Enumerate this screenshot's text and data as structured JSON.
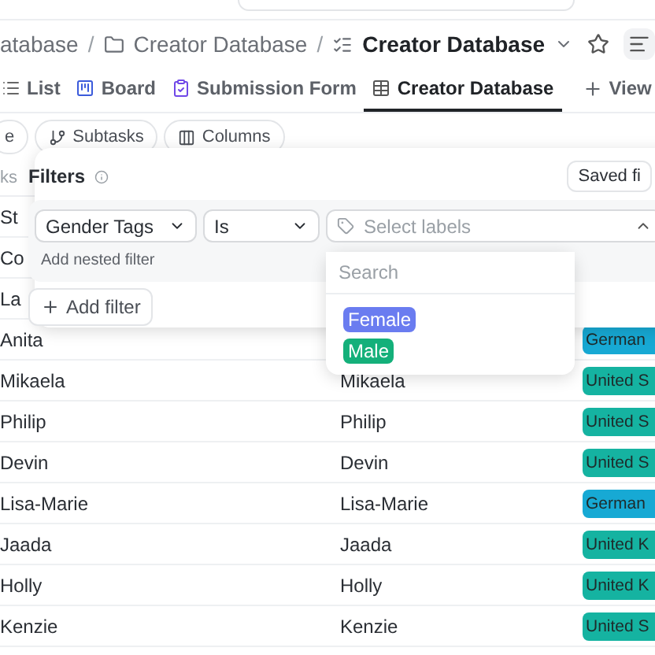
{
  "breadcrumb": [
    {
      "label": "atabase",
      "kind": "plain"
    },
    {
      "label": "Creator Database",
      "kind": "folder",
      "separator": "/"
    },
    {
      "label": "Creator Database",
      "kind": "current",
      "separator": "/"
    }
  ],
  "tabs": [
    {
      "label": "List",
      "kind": "list",
      "selected": false
    },
    {
      "label": "Board",
      "kind": "board",
      "selected": false
    },
    {
      "label": "Submission Form",
      "kind": "form",
      "selected": false
    },
    {
      "label": "Creator Database",
      "kind": "table",
      "selected": true
    }
  ],
  "add_view": "View",
  "toolbar": [
    {
      "label": "e",
      "kind": "none"
    },
    {
      "label": "Subtasks",
      "kind": "subtasks"
    },
    {
      "label": "Columns",
      "kind": "columns"
    }
  ],
  "table": {
    "header": "ks",
    "rows": [
      {
        "column_1": "St"
      },
      {
        "column_1": "Co"
      },
      {
        "column_1": "La"
      },
      {
        "column_1": "Anita",
        "column_3": {
          "label": "German",
          "color": "#17a9d4"
        }
      },
      {
        "column_1": "Mikaela",
        "column_2": "Mikaela",
        "column_3": {
          "label": "United S",
          "color": "#15b3a1"
        }
      },
      {
        "column_1": "Philip",
        "column_2": "Philip",
        "column_3": {
          "label": "United S",
          "color": "#15b3a1"
        }
      },
      {
        "column_1": "Devin",
        "column_2": "Devin",
        "column_3": {
          "label": "United S",
          "color": "#15b3a1"
        }
      },
      {
        "column_1": "Lisa-Marie",
        "column_2": "Lisa-Marie",
        "column_3": {
          "label": "German",
          "color": "#17a9d4"
        }
      },
      {
        "column_1": "Jaada",
        "column_2": "Jaada",
        "column_3": {
          "label": "United K",
          "color": "#15b3a1"
        }
      },
      {
        "column_1": "Holly",
        "column_2": "Holly",
        "column_3": {
          "label": "United K",
          "color": "#15b3a1"
        }
      },
      {
        "column_1": "Kenzie",
        "column_2": "Kenzie",
        "column_3": {
          "label": "United S",
          "color": "#15b3a1"
        }
      }
    ]
  },
  "filters": {
    "title": "Filters",
    "saved_button": "Saved fi",
    "field": "Gender Tags",
    "operator": "Is",
    "value_placeholder": "Select labels",
    "nested": "Add nested filter",
    "add_button": "Add filter",
    "dropdown": {
      "search_placeholder": "Search",
      "options": [
        {
          "label": "Female",
          "color": "#6a7cf0"
        },
        {
          "label": "Male",
          "color": "#14b07a"
        }
      ]
    }
  }
}
